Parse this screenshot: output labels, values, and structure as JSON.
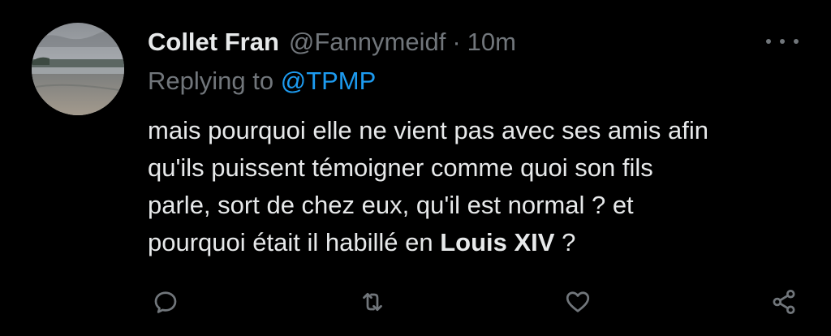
{
  "author": {
    "name": "Collet Fran",
    "handle": "@Fannymeidf",
    "separator": "·",
    "time": "10m",
    "avatar": "avatar-photo"
  },
  "more_icon": "more-horizontal-icon",
  "reply": {
    "prefix": "Replying to ",
    "mention": "@TPMP"
  },
  "body": {
    "line1": "mais pourquoi elle ne vient pas avec ses amis afin",
    "line2": "qu'ils puissent témoigner comme quoi son fils",
    "line3": "parle, sort de chez eux, qu'il est normal ? et",
    "line4_start": "pourquoi était il habillé en ",
    "line4_bold": "Louis XIV",
    "line4_end": " ?"
  },
  "actions": [
    {
      "icon": "reply-icon"
    },
    {
      "icon": "retweet-icon"
    },
    {
      "icon": "like-icon"
    },
    {
      "icon": "share-icon"
    }
  ],
  "colors": {
    "background": "#000000",
    "text": "#e7e9ea",
    "secondary": "#71767b",
    "accent": "#1d9bf0"
  }
}
